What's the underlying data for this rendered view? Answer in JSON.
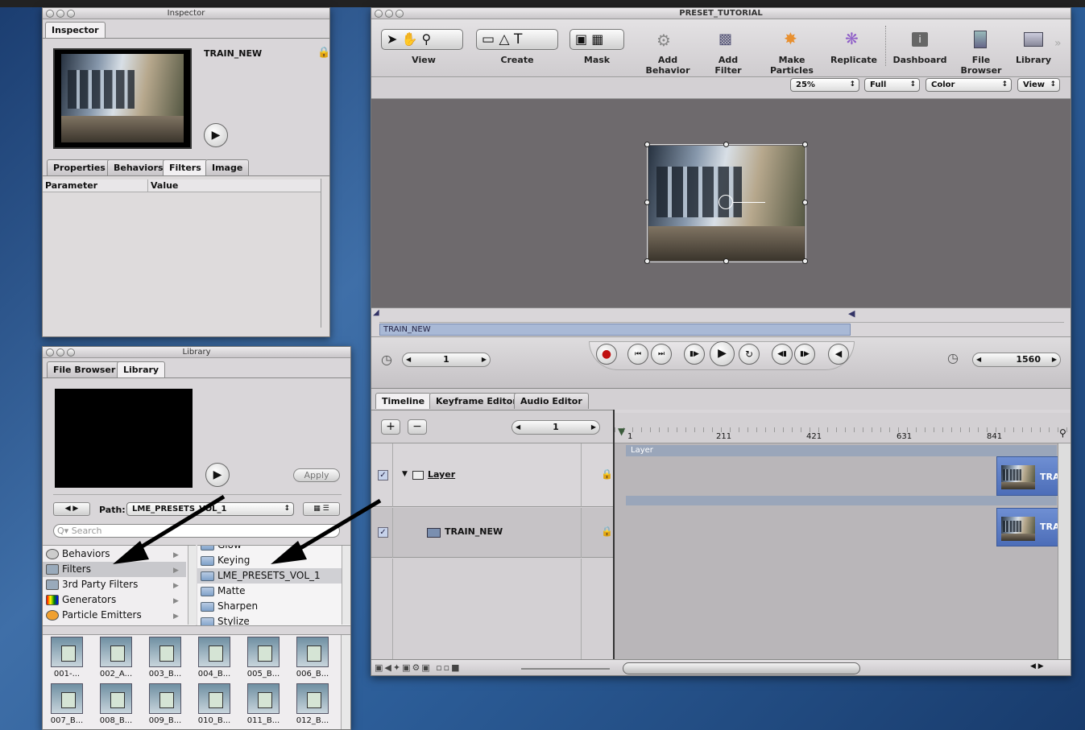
{
  "inspector": {
    "title": "Inspector",
    "tab": "Inspector",
    "clip_name": "TRAIN_NEW",
    "tabs": [
      "Properties",
      "Behaviors",
      "Filters",
      "Image"
    ],
    "columns": [
      "Parameter",
      "Value"
    ]
  },
  "library": {
    "title": "Library",
    "tabs": [
      "File Browser",
      "Library"
    ],
    "apply": "Apply",
    "path_label": "Path:",
    "path_value": "LME_PRESETS_VOL_1",
    "search_placeholder": "Search",
    "categories": [
      "Behaviors",
      "Filters",
      "3rd Party Filters",
      "Generators",
      "Particle Emitters"
    ],
    "folders": [
      "Glow",
      "Keying",
      "LME_PRESETS_VOL_1",
      "Matte",
      "Sharpen",
      "Stylize"
    ],
    "presets": [
      "001-...",
      "002_A...",
      "003_B...",
      "004_B...",
      "005_B...",
      "006_B...",
      "007_B...",
      "008_B...",
      "009_B...",
      "010_B...",
      "011_B...",
      "012_B..."
    ]
  },
  "main": {
    "title": "PRESET_TUTORIAL",
    "toolbar": [
      "View",
      "Create",
      "Mask",
      "Add Behavior",
      "Add Filter",
      "Make Particles",
      "Replicate",
      "Dashboard",
      "File Browser",
      "Library"
    ],
    "zoom": "25%",
    "quality": "Full",
    "channel": "Color",
    "view": "View",
    "mini_clip": "TRAIN_NEW",
    "start_frame": "1",
    "end_frame": "1560",
    "tabs": [
      "Timeline",
      "Keyframe Editor",
      "Audio Editor"
    ],
    "frame_field": "1",
    "ruler": [
      "1",
      "211",
      "421",
      "631",
      "841"
    ],
    "group_label": "Layer",
    "layers": [
      {
        "name": "Layer",
        "clip": "TRAIN_NEW"
      },
      {
        "name": "TRAIN_NEW",
        "clip": "TRAIN_NEW"
      }
    ]
  }
}
